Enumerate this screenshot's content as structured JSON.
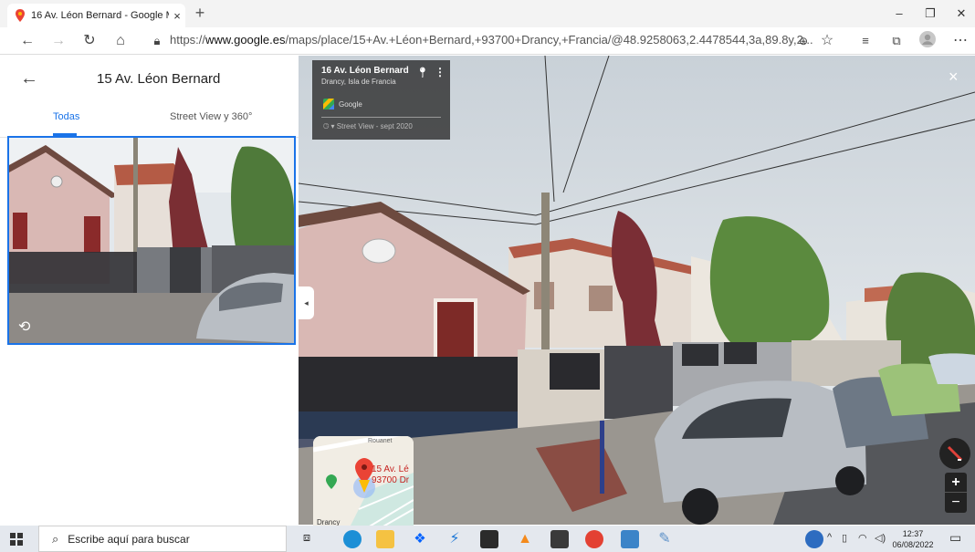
{
  "browser": {
    "tab_title": "16 Av. Léon Bernard - Google M",
    "tab_close": "×",
    "new_tab": "+",
    "url_prefix": "https://",
    "url_host": "www.google.es",
    "url_path": "/maps/place/15+Av.+Léon+Bernard,+93700+Drancy,+Francia/@48.9258063,2.4478544,3a,89.8y,2..."
  },
  "window": {
    "minimize": "–",
    "maximize": "❐",
    "close": "✕"
  },
  "left_panel": {
    "back_icon": "←",
    "title": "15 Av. Léon Bernard",
    "tabs": [
      {
        "label": "Todas",
        "active": true
      },
      {
        "label": "Street View y 360°",
        "active": false
      }
    ]
  },
  "street_view": {
    "info_title": "16 Av. Léon Bernard",
    "info_subtitle": "Drancy, Isla de Francia",
    "provider": "Google",
    "capture_date": "Street View - sept 2020",
    "close": "×",
    "collapse": "◂",
    "minimap_label_1": "15 Av. Lé",
    "minimap_label_2": "93700 Dr",
    "minimap_street": "Rouanet",
    "minimap_city": "Drancy",
    "zoom_in": "+",
    "zoom_out": "−"
  },
  "taskbar": {
    "search_placeholder": "Escribe aquí para buscar",
    "time": "12:37",
    "date": "06/08/2022"
  },
  "colors": {
    "accent": "#1a73e8",
    "sky": "#dfe5ea",
    "house": "#d9b8b4"
  }
}
